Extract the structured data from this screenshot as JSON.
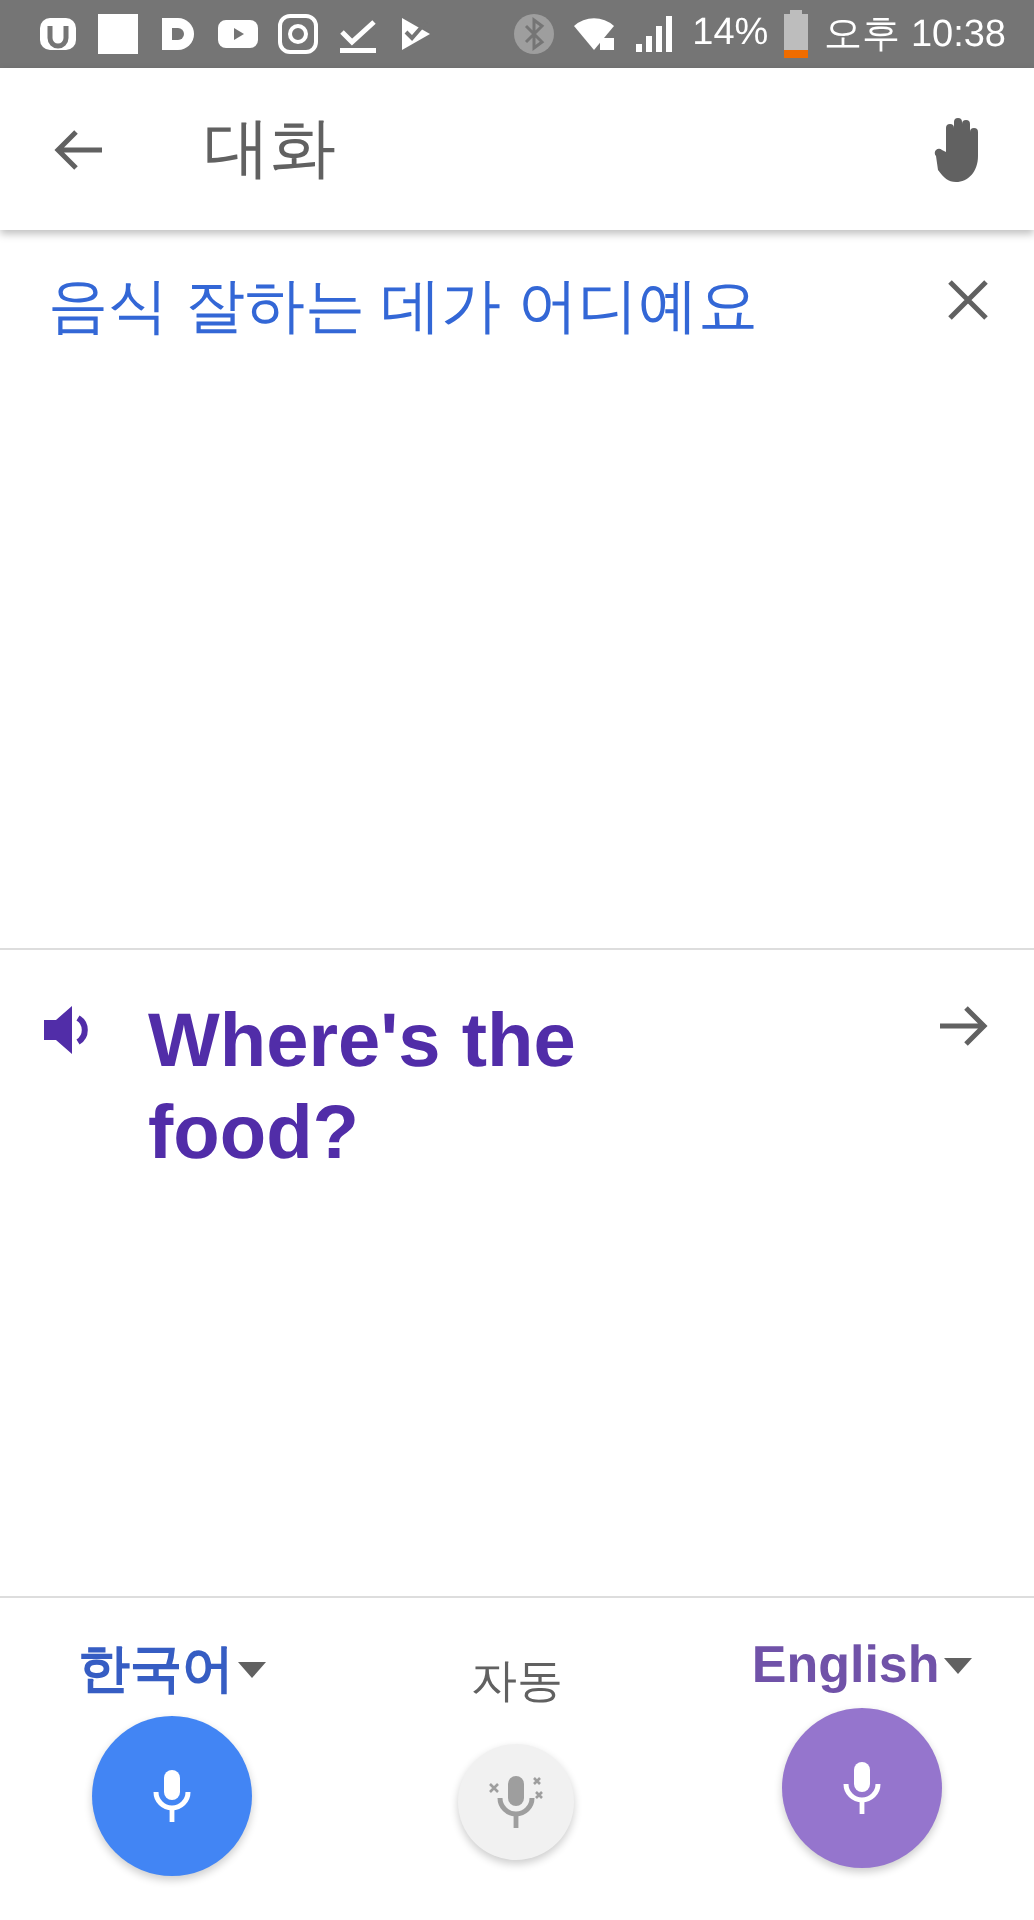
{
  "status_bar": {
    "battery": "14%",
    "time": "오후 10:38"
  },
  "app_bar": {
    "title": "대화"
  },
  "source": {
    "text": "음식 잘하는 데가 어디예요"
  },
  "translation": {
    "text": "Where's the food?"
  },
  "languages": [
    {
      "label": "한국어",
      "color": "#4285f4"
    },
    {
      "label": "English",
      "color": "#9575cd"
    }
  ],
  "auto": {
    "label": "자동"
  }
}
